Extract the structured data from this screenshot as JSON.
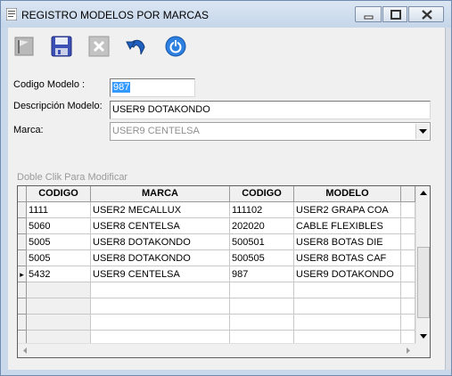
{
  "window": {
    "title": "REGISTRO MODELOS POR MARCAS"
  },
  "toolbar": {
    "buttons": [
      {
        "name": "flag-icon"
      },
      {
        "name": "save-icon"
      },
      {
        "name": "delete-icon"
      },
      {
        "name": "undo-icon"
      },
      {
        "name": "power-icon"
      }
    ]
  },
  "form": {
    "codigo_label": "Codigo Modelo :",
    "codigo_value": "987",
    "descripcion_label": "Descripción Modelo:",
    "descripcion_value": "USER9 DOTAKONDO",
    "marca_label": "Marca:",
    "marca_value": "USER9 CENTELSA"
  },
  "grid": {
    "hint": "Doble Clik Para Modificar",
    "headers": [
      "CODIGO",
      "MARCA",
      "CODIGO",
      "MODELO"
    ],
    "rows": [
      [
        "1111",
        "USER2 MECALLUX",
        "111102",
        "USER2 GRAPA COA"
      ],
      [
        "5060",
        "USER8 CENTELSA",
        "202020",
        "CABLE FLEXIBLES"
      ],
      [
        "5005",
        "USER8 DOTAKONDO",
        "500501",
        "USER8 BOTAS DIE"
      ],
      [
        "5005",
        "USER8 DOTAKONDO",
        "500505",
        "USER8 BOTAS CAF"
      ],
      [
        "5432",
        "USER9 CENTELSA",
        "987",
        "USER9 DOTAKONDO"
      ]
    ],
    "current_row_marker": "▸"
  },
  "colors": {
    "selection": "#3399ff",
    "window_frame": "#c9d8ea",
    "accent_blue": "#1f5fbf"
  }
}
